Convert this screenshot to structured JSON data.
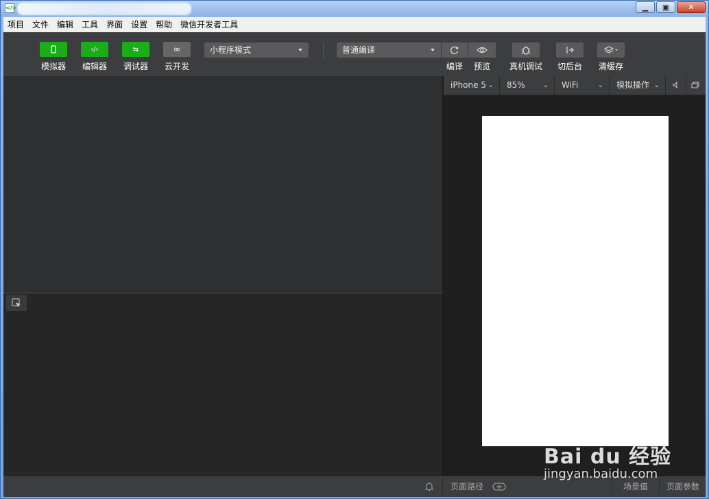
{
  "window": {
    "app_icon": "<∕>",
    "controls": {
      "minimize": "▁",
      "maximize": "▣",
      "close": "✕"
    }
  },
  "menu": [
    "项目",
    "文件",
    "编辑",
    "工具",
    "界面",
    "设置",
    "帮助",
    "微信开发者工具"
  ],
  "toolbar": {
    "modes": [
      {
        "label": "模拟器",
        "icon": "phone-icon",
        "glyph": "▯",
        "active": true
      },
      {
        "label": "编辑器",
        "icon": "code-icon",
        "glyph": "‹/›",
        "active": true
      },
      {
        "label": "调试器",
        "icon": "debug-arrows-icon",
        "glyph": "⇆",
        "active": true
      },
      {
        "label": "云开发",
        "icon": "cloud-link-icon",
        "glyph": "∞",
        "active": false
      }
    ],
    "project_mode": "小程序模式",
    "compile_mode": "普通编译",
    "actions": [
      {
        "label": "编译",
        "icon": "refresh-icon"
      },
      {
        "label": "预览",
        "icon": "eye-icon"
      },
      {
        "label": "真机调试",
        "icon": "bug-icon"
      },
      {
        "label": "切后台",
        "icon": "background-switch-icon"
      },
      {
        "label": "清缓存",
        "icon": "layers-icon"
      }
    ],
    "accent_color": "#1aad19"
  },
  "simulator": {
    "device": "iPhone 5",
    "zoom": "85%",
    "network": "WiFi",
    "operation": "模拟操作"
  },
  "statusbar": {
    "page_path": "页面路径",
    "scene_value": "场景值",
    "page_params": "页面参数"
  },
  "watermark": {
    "brand": "Bai du 经验",
    "url": "jingyan.baidu.com"
  }
}
